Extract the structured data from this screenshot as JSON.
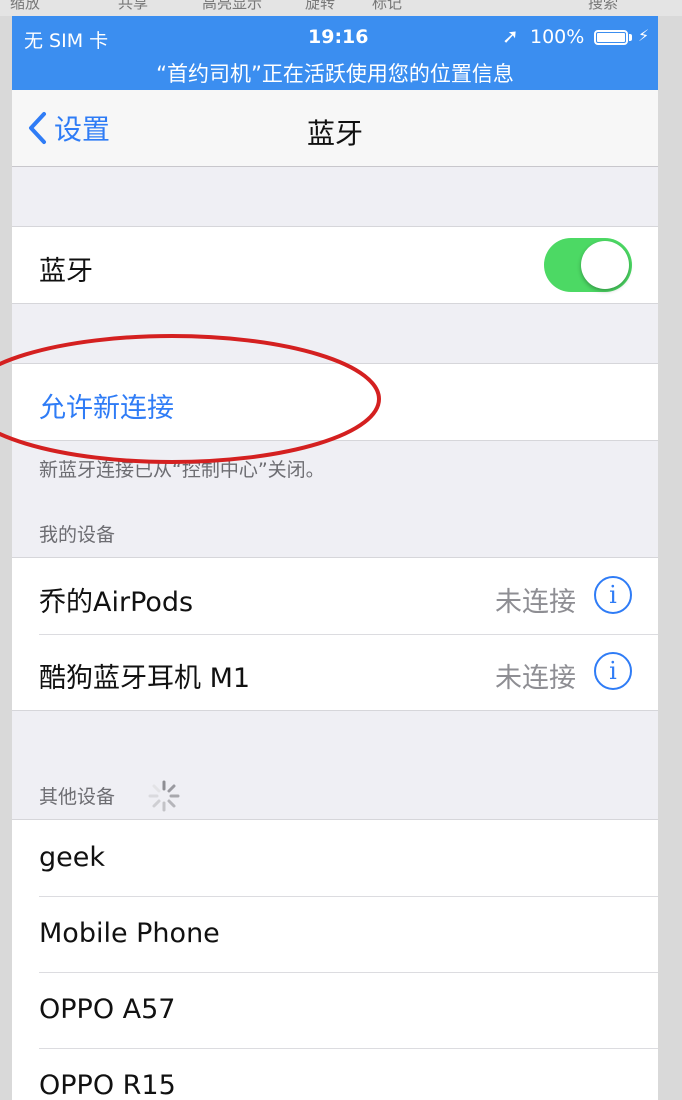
{
  "viewer_toolbar": {
    "items": [
      "缩放",
      "共享",
      "高亮显示",
      "旋转",
      "标记",
      "搜索"
    ]
  },
  "status_bar": {
    "carrier": "无 SIM 卡",
    "time": "19:16",
    "battery_percent": "100%",
    "location_banner": "“首约司机”正在活跃使用您的位置信息"
  },
  "nav": {
    "back_label": "设置",
    "title": "蓝牙"
  },
  "bluetooth": {
    "label": "蓝牙",
    "enabled": true
  },
  "allow_new": {
    "label": "允许新连接",
    "note": "新蓝牙连接已从“控制中心”关闭。"
  },
  "my_devices": {
    "header": "我的设备",
    "items": [
      {
        "name": "乔的AirPods",
        "status": "未连接",
        "info": "i"
      },
      {
        "name": "酷狗蓝牙耳机 M1",
        "status": "未连接",
        "info": "i"
      }
    ]
  },
  "other_devices": {
    "header": "其他设备",
    "items": [
      {
        "name": "geek"
      },
      {
        "name": "Mobile Phone"
      },
      {
        "name": "OPPO A57"
      },
      {
        "name": "OPPO R15"
      }
    ]
  },
  "colors": {
    "status_bar": "#3b8ef0",
    "accent": "#2f7cf6",
    "toggle_on": "#4cd964",
    "annotation": "#d42020"
  }
}
